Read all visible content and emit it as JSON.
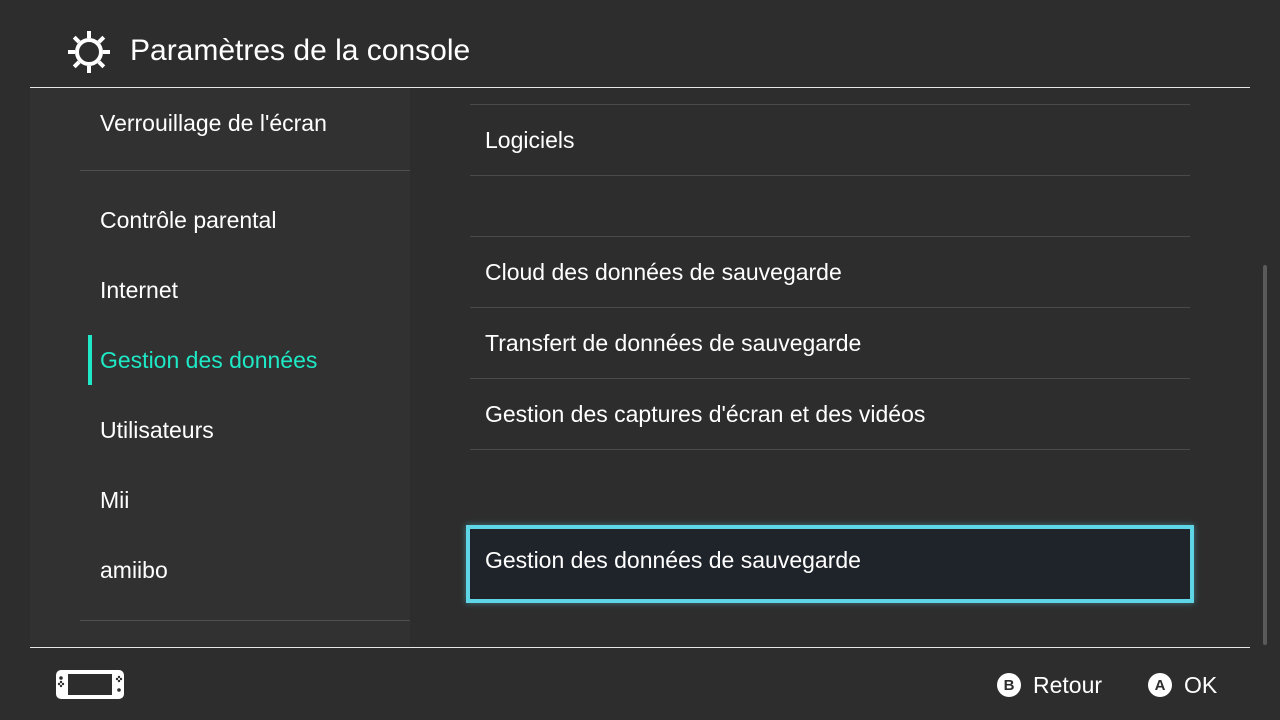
{
  "header": {
    "title": "Paramètres de la console",
    "icon": "gear-icon"
  },
  "sidebar": {
    "items": [
      {
        "label": "Verrouillage de l'écran",
        "active": false
      },
      {
        "label": "Contrôle parental",
        "active": false
      },
      {
        "label": "Internet",
        "active": false
      },
      {
        "label": "Gestion des données",
        "active": true
      },
      {
        "label": "Utilisateurs",
        "active": false
      },
      {
        "label": "Mii",
        "active": false
      },
      {
        "label": "amiibo",
        "active": false
      }
    ]
  },
  "main": {
    "items": [
      {
        "label": "Logiciels",
        "selected": false
      },
      {
        "label": "Cloud des données de sauvegarde",
        "selected": false
      },
      {
        "label": "Transfert de données de sauvegarde",
        "selected": false
      },
      {
        "label": "Gestion des captures d'écran et des vidéos",
        "selected": false
      },
      {
        "label": "Gestion des données de sauvegarde",
        "selected": true
      }
    ]
  },
  "footer": {
    "console_icon": "handheld-console-icon",
    "back": {
      "button": "B",
      "label": "Retour"
    },
    "ok": {
      "button": "A",
      "label": "OK"
    }
  },
  "colors": {
    "background": "#2d2d2d",
    "sidebar_background": "#313131",
    "accent_active": "#1ee8c5",
    "selection_border": "#5fd6e8",
    "selection_fill": "#1f232a"
  }
}
